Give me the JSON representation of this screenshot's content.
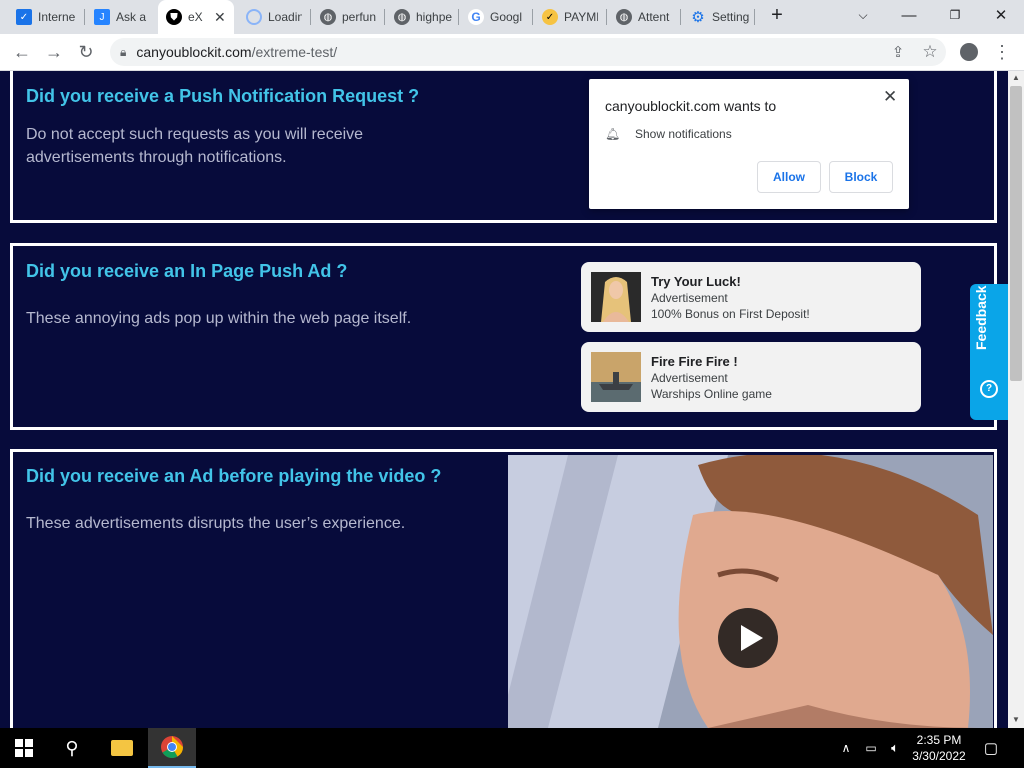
{
  "browser": {
    "tabs": [
      {
        "label": "Interne",
        "icon": "checkbox-icon",
        "active": false
      },
      {
        "label": "Ask a (",
        "icon": "jira-icon",
        "active": false
      },
      {
        "label": "eX",
        "icon": "shield-icon",
        "active": true
      },
      {
        "label": "Loadin",
        "icon": "loading-icon",
        "active": false
      },
      {
        "label": "perfun",
        "icon": "globe-icon",
        "active": false
      },
      {
        "label": "highpe",
        "icon": "globe-icon",
        "active": false
      },
      {
        "label": "Googl",
        "icon": "google-icon",
        "active": false
      },
      {
        "label": "PAYME",
        "icon": "check-icon",
        "active": false
      },
      {
        "label": "Attent",
        "icon": "globe-icon",
        "active": false
      },
      {
        "label": "Setting",
        "icon": "gear-icon",
        "active": false
      }
    ],
    "new_tab": "+",
    "url_host": "canyoublockit.com",
    "url_path": "/extreme-test/"
  },
  "notification_prompt": {
    "site_text": "canyoublockit.com wants to",
    "permission": "Show notifications",
    "allow": "Allow",
    "block": "Block"
  },
  "sections": [
    {
      "title": "Did you receive a Push Notification Request ?",
      "description": "Do not accept such requests as you will receive advertisements through notifications."
    },
    {
      "title": "Did you receive an In Page Push Ad ?",
      "description": "These annoying ads pop up within the web page itself."
    },
    {
      "title": "Did you receive an Ad before playing the video ?",
      "description": "These advertisements disrupts the user’s experience."
    }
  ],
  "ads": [
    {
      "title": "Try Your Luck!",
      "label": "Advertisement",
      "text": "100% Bonus on First Deposit!"
    },
    {
      "title": "Fire Fire Fire !",
      "label": "Advertisement",
      "text": "Warships Online game"
    }
  ],
  "feedback": {
    "label": "Feedback"
  },
  "taskbar": {
    "time": "2:35 PM",
    "date": "3/30/2022"
  }
}
